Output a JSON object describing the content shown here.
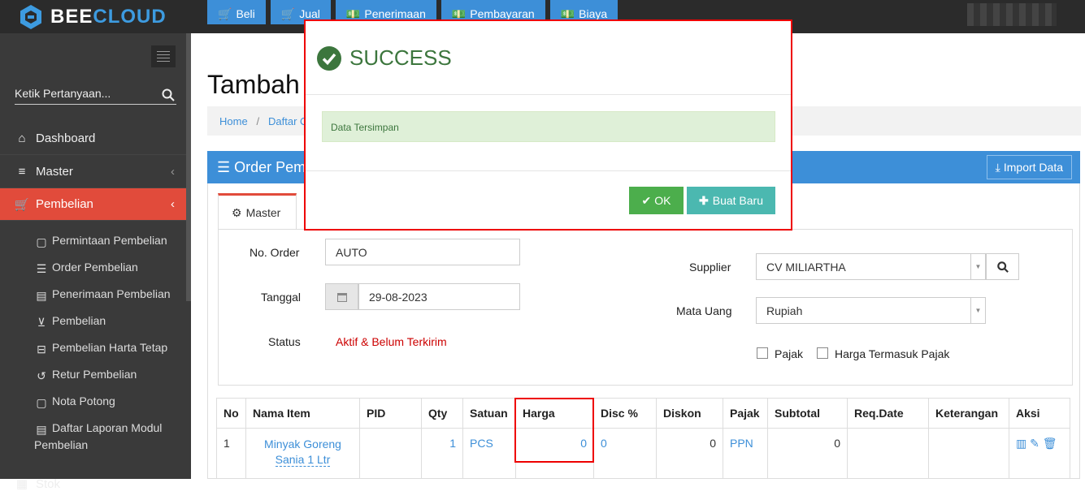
{
  "brand": {
    "bee": "BEE",
    "cloud": "CLOUD"
  },
  "topnav": [
    {
      "label": "Beli",
      "icon": "cart-icon"
    },
    {
      "label": "Jual",
      "icon": "cart-icon"
    },
    {
      "label": "Penerimaan",
      "icon": "money-icon"
    },
    {
      "label": "Pembayaran",
      "icon": "money-icon"
    },
    {
      "label": "Biaya",
      "icon": "money-icon"
    }
  ],
  "sidebar": {
    "search_placeholder": "Ketik Pertanyaan...",
    "items": [
      {
        "label": "Dashboard",
        "icon": "home-icon"
      },
      {
        "label": "Master",
        "icon": "database-icon"
      },
      {
        "label": "Pembelian",
        "icon": "cart-icon"
      }
    ],
    "sub_items": [
      {
        "label": "Permintaan Pembelian"
      },
      {
        "label": "Order Pembelian"
      },
      {
        "label": "Penerimaan Pembelian"
      },
      {
        "label": "Pembelian"
      },
      {
        "label": "Pembelian Harta Tetap"
      },
      {
        "label": "Retur Pembelian"
      },
      {
        "label": "Nota Potong"
      },
      {
        "label": "Daftar Laporan Modul",
        "label2": "Pembelian"
      }
    ],
    "next_item": "Stok"
  },
  "main": {
    "page_title": "Tambah",
    "breadcrumb": {
      "home": "Home",
      "current": "Daftar O"
    },
    "panel_title": "Order Pemb",
    "import_label": "Import Data",
    "tab_label": "Master",
    "form": {
      "no_order_label": "No. Order",
      "no_order_value": "AUTO",
      "tanggal_label": "Tanggal",
      "tanggal_value": "29-08-2023",
      "status_label": "Status",
      "status_value": "Aktif & Belum Terkirim",
      "supplier_label": "Supplier",
      "supplier_value": "CV MILIARTHA",
      "mata_uang_label": "Mata Uang",
      "mata_uang_value": "Rupiah",
      "pajak_label": "Pajak",
      "harga_termasuk_label": "Harga Termasuk Pajak"
    },
    "table": {
      "headers": [
        "No",
        "Nama Item",
        "PID",
        "Qty",
        "Satuan",
        "Harga",
        "Disc %",
        "Diskon",
        "Pajak",
        "Subtotal",
        "Req.Date",
        "Keterangan",
        "Aksi"
      ],
      "rows": [
        {
          "no": "1",
          "nama1": "Minyak Goreng",
          "nama2": "Sania 1 Ltr",
          "pid": "",
          "qty": "1",
          "satuan": "PCS",
          "harga": "0",
          "disc": "0",
          "diskon": "0",
          "pajak": "PPN",
          "subtotal": "0",
          "req_date": "",
          "keterangan": ""
        }
      ]
    }
  },
  "modal": {
    "title": "SUCCESS",
    "message": "Data Tersimpan",
    "ok_label": "OK",
    "new_label": "Buat Baru"
  },
  "colors": {
    "accent": "#3d8fd8",
    "active": "#e14b3b",
    "success": "#4cae4c"
  }
}
